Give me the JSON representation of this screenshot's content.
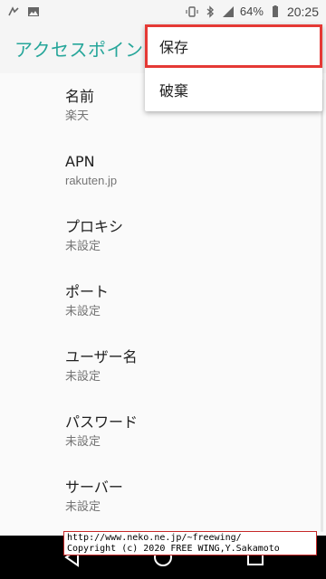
{
  "status_bar": {
    "battery_percent": "64%",
    "time": "20:25",
    "icons": [
      "nfc-icon",
      "image-icon",
      "vibrate-icon",
      "bluetooth-icon",
      "signal-icon",
      "battery-icon"
    ]
  },
  "app_bar": {
    "title": "アクセスポイン"
  },
  "menu": {
    "items": [
      {
        "label": "保存",
        "highlighted": true,
        "highlight_color": "#e53935"
      },
      {
        "label": "破棄",
        "highlighted": false
      }
    ]
  },
  "settings": [
    {
      "title": "名前",
      "value": "楽天"
    },
    {
      "title": "APN",
      "value": "rakuten.jp"
    },
    {
      "title": "プロキシ",
      "value": "未設定"
    },
    {
      "title": "ポート",
      "value": "未設定"
    },
    {
      "title": "ユーザー名",
      "value": "未設定"
    },
    {
      "title": "パスワード",
      "value": "未設定"
    },
    {
      "title": "サーバー",
      "value": "未設定"
    }
  ],
  "watermark": {
    "line1": "http://www.neko.ne.jp/~freewing/",
    "line2": "Copyright (c) 2020 FREE WING,Y.Sakamoto"
  },
  "colors": {
    "accent": "#26a69a",
    "highlight": "#e53935",
    "background": "#fafafa"
  }
}
